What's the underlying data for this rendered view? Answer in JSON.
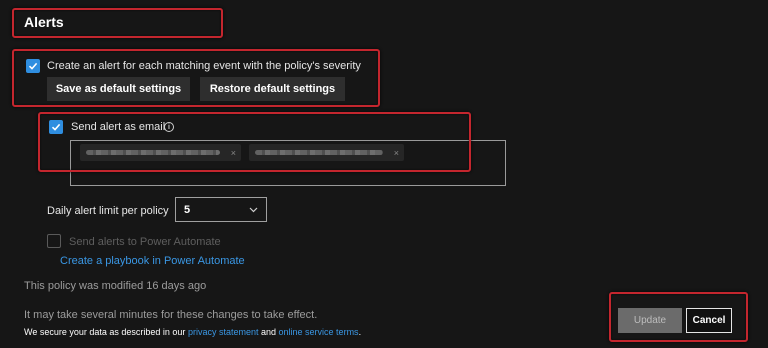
{
  "section": {
    "title": "Alerts"
  },
  "alert_option": {
    "checkbox_label": "Create an alert for each matching event with the policy's severity",
    "checked": true,
    "save_default_label": "Save as default settings",
    "restore_default_label": "Restore default settings"
  },
  "email_option": {
    "checkbox_label": "Send alert as email",
    "checked": true,
    "info_icon": "info-icon",
    "recipient_chips": [
      {
        "value": "",
        "remove_glyph": "×"
      },
      {
        "value": "",
        "remove_glyph": "×"
      }
    ]
  },
  "daily_limit": {
    "label": "Daily alert limit per policy",
    "selected_value": "5",
    "chevron_icon": "chevron-down-icon"
  },
  "power_automate": {
    "checkbox_label": "Send alerts to Power Automate",
    "checked": false,
    "playbook_link": "Create a playbook in Power Automate"
  },
  "status": {
    "modified_text": "This policy was modified 16 days ago",
    "delay_notice": "It may take several minutes for these changes to take effect."
  },
  "privacy": {
    "prefix": "We secure your data as described in our",
    "privacy_link": "privacy statement",
    "middle": "and",
    "terms_link": "online service terms",
    "suffix": "."
  },
  "actions": {
    "update_label": "Update",
    "cancel_label": "Cancel"
  },
  "colors": {
    "background": "#161616",
    "accent": "#2f8ee0",
    "link": "#3a97e4",
    "highlight": "#c4262e"
  }
}
